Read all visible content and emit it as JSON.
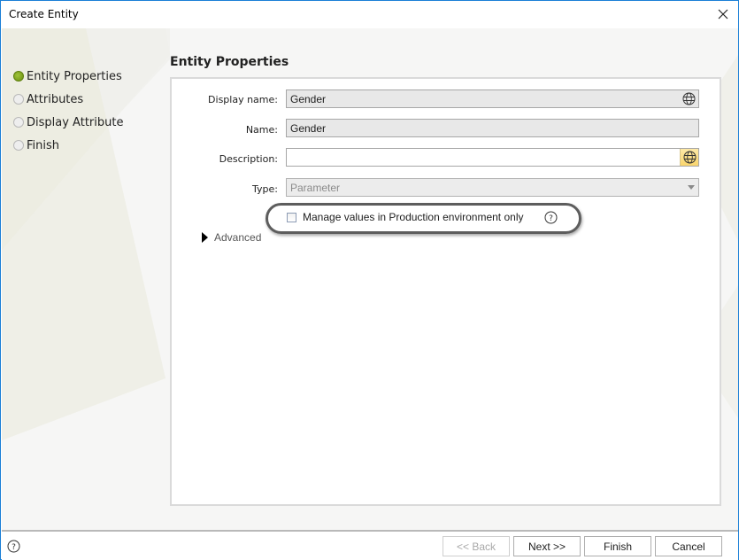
{
  "window": {
    "title": "Create Entity",
    "close_icon": "close-icon"
  },
  "wizard_steps": [
    {
      "label": "Entity Properties",
      "active": true
    },
    {
      "label": "Attributes",
      "active": false
    },
    {
      "label": "Display Attribute",
      "active": false
    },
    {
      "label": "Finish",
      "active": false
    }
  ],
  "section": {
    "title": "Entity Properties"
  },
  "form": {
    "display_name": {
      "label": "Display name:",
      "value": "Gender",
      "icon": "globe-icon"
    },
    "name": {
      "label": "Name:",
      "value": "Gender"
    },
    "description": {
      "label": "Description:",
      "value": "",
      "icon": "globe-icon"
    },
    "type": {
      "label": "Type:",
      "value": "Parameter",
      "disabled": true
    },
    "manage_values_checkbox": {
      "label": "Manage values in Production environment only",
      "checked": false,
      "help_icon": "help-icon"
    },
    "advanced": {
      "label": "Advanced",
      "expanded": false
    }
  },
  "footer": {
    "help_icon": "help-icon",
    "buttons": {
      "back": {
        "label": "<< Back",
        "enabled": false
      },
      "next": {
        "label": "Next >>",
        "enabled": true
      },
      "finish": {
        "label": "Finish",
        "enabled": true
      },
      "cancel": {
        "label": "Cancel",
        "enabled": true
      }
    }
  },
  "colors": {
    "window_border": "#1a7fd6",
    "active_step": "#7fa520",
    "highlight_globe": "#f9d56c",
    "annotation_oval": "#5d5d5d"
  }
}
